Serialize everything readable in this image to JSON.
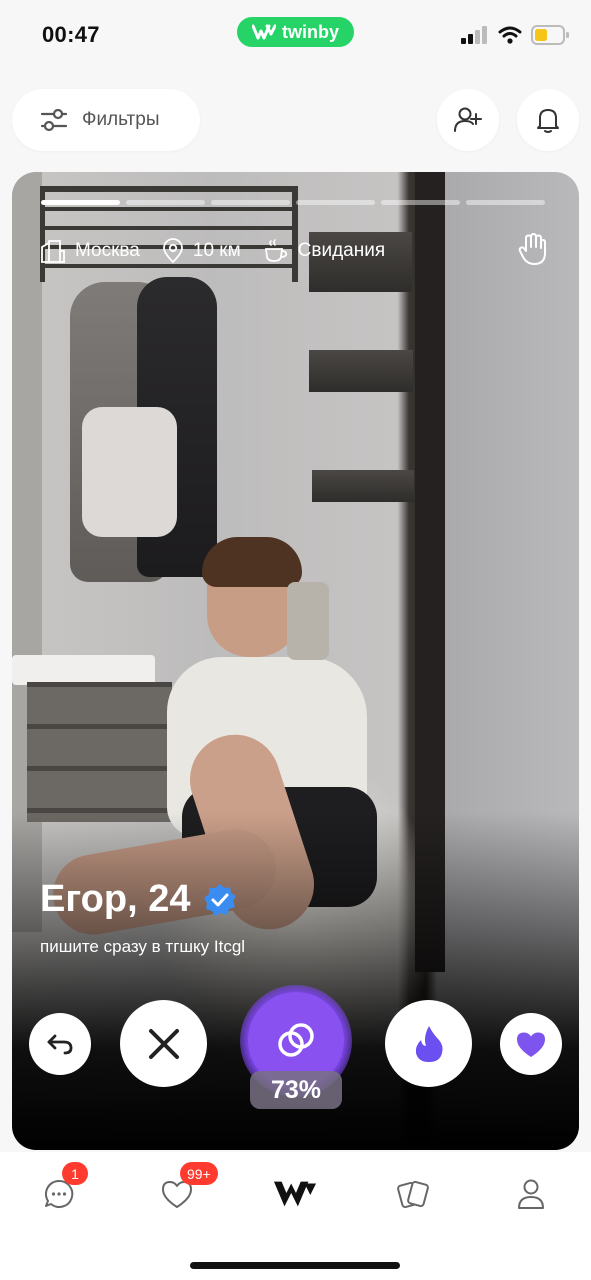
{
  "status_bar": {
    "time": "00:47",
    "app_badge": "twinby",
    "app_badge_color": "#25d366"
  },
  "top": {
    "filters_label": "Фильтры",
    "add_friend_icon": "add-user-icon",
    "notifications_icon": "bell-icon"
  },
  "profile": {
    "photo_count": 6,
    "active_photo": 1,
    "city": "Москва",
    "distance": "10 км",
    "goal": "Свидания",
    "name_age": "Егор, 24",
    "verified": true,
    "bio": "пишите сразу в тгшку Itcgl"
  },
  "actions": {
    "match_percent": "73%",
    "accent_color": "#8851f0"
  },
  "tabbar": {
    "chat_badge": "1",
    "likes_badge": "99+"
  }
}
